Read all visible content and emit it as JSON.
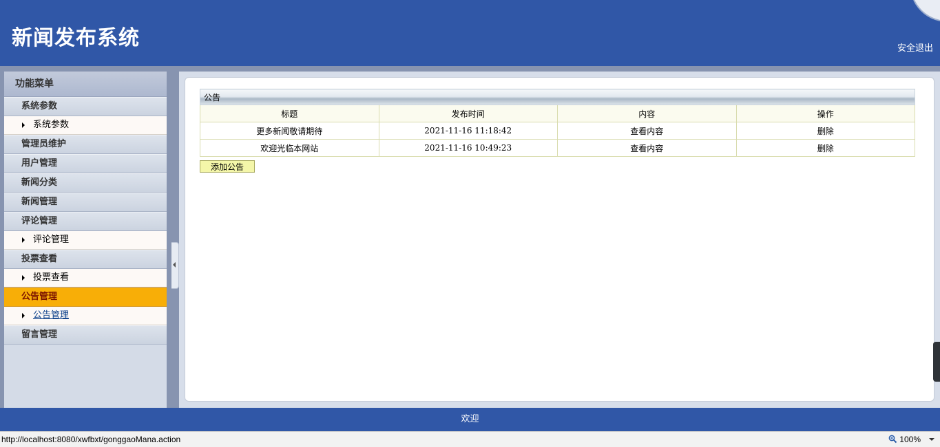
{
  "header": {
    "title": "新闻发布系统",
    "logout_label": "安全退出"
  },
  "sidebar": {
    "title": "功能菜单",
    "groups": [
      {
        "label": "系统参数",
        "sub": "系统参数"
      },
      {
        "label": "管理员维护"
      },
      {
        "label": "用户管理"
      },
      {
        "label": "新闻分类"
      },
      {
        "label": "新闻管理"
      },
      {
        "label": "评论管理",
        "sub": "评论管理"
      },
      {
        "label": "投票查看",
        "sub": "投票查看"
      },
      {
        "label": "公告管理",
        "sub": "公告管理",
        "active": true
      },
      {
        "label": "留言管理"
      }
    ]
  },
  "table": {
    "caption": "公告",
    "headers": [
      "标题",
      "发布时间",
      "内容",
      "操作"
    ],
    "rows": [
      {
        "title": "更多新闻敬请期待",
        "time": "2021-11-16 11:18:42",
        "content": "查看内容",
        "action": "删除"
      },
      {
        "title": "欢迎光临本网站",
        "time": "2021-11-16 10:49:23",
        "content": "查看内容",
        "action": "删除"
      }
    ]
  },
  "add_button_label": "添加公告",
  "footer": {
    "text": "欢迎"
  },
  "statusbar": {
    "url": "http://localhost:8080/xwfbxt/gonggaoMana.action",
    "zoom": "100%"
  },
  "colors": {
    "header": "#3057a7",
    "active_menu": "#f8ae07"
  }
}
